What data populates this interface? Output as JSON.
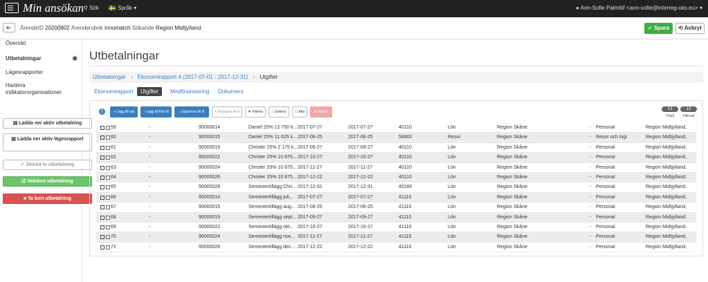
{
  "app": {
    "title": "Min ansökan",
    "nav": {
      "search": "Sök",
      "language": "Språk"
    },
    "user": "Ann-Sofie Palmlöf <ann-sofie@interreg-oks.eu>"
  },
  "subbar": {
    "arende_label": "ÄrendeID",
    "arende_id": "20200802",
    "rubrik_label": "Ärenderubrik",
    "rubrik_value": "Innomatch",
    "sokande_label": "Sökande",
    "sokande_value": "Region Midtjylland.",
    "save_label": "Spara",
    "cancel_label": "Avbryt"
  },
  "sidebar": {
    "items": [
      {
        "label": "Översikt"
      },
      {
        "label": "Utbetalningar"
      },
      {
        "label": "Lägesrapporter"
      },
      {
        "label": "Hantera indikatororganisationer"
      }
    ],
    "buttons": {
      "download_payment": "Ladda ner aktiv utbetalning",
      "download_report": "Ladda ner aktiv lägesrapport",
      "send_payment": "Skicka in utbetalning",
      "validate_payment": "Validera utbetalning",
      "delete_payment": "Ta bort utbetalning"
    }
  },
  "main": {
    "title": "Utbetalningar",
    "breadcrumb": {
      "item1": "Utbetalningar",
      "item2": "Ekonomirapport 4 (2017-07-01 - 2017-12-31)",
      "current": "Utgifter"
    },
    "tabs": {
      "ekonomirapport": "Ekonomirapport",
      "utgifter": "Utgifter",
      "medfinansiering": "Medfinansiering",
      "dokument": "Dokument"
    },
    "toolbar": {
      "add_row": "Lägg till rad",
      "add_from_file": "Lägg till från fil",
      "export_file": "Exportera till fil",
      "edit_many": "Redigera flera",
      "filter": "Filtrera",
      "sort": "Sortera",
      "all": "Alla",
      "delete": "Ta bort"
    },
    "counts": {
      "total": "13",
      "total_label": "Totalt",
      "filtered": "13",
      "filtered_label": "Filtrerat"
    },
    "rows": [
      {
        "id": "59",
        "dash": "-",
        "ver": "90000014",
        "text": "Daniel 25% 12 750 k...",
        "date1": "2017-07-27",
        "date2": "2017-07-27",
        "konto": "40110",
        "typ": "Lön",
        "region": "Region Skåne",
        "dash2": "-",
        "kat": "Personal",
        "org": "Region Midtjylland,"
      },
      {
        "id": "60",
        "dash": "-",
        "ver": "90000015",
        "text": "Daniel 25% 11 625 k...",
        "date1": "2017-08-25",
        "date2": "2017-08-25",
        "konto": "58900",
        "typ": "Resor",
        "region": "Region Skåne",
        "dash2": "-",
        "kat": "Resor och logi",
        "org": "Region Midtjylland,"
      },
      {
        "id": "61",
        "dash": "-",
        "ver": "90000019",
        "text": "Christer 25% 2 175 k...",
        "date1": "2017-09-27",
        "date2": "2017-09-27",
        "konto": "40110",
        "typ": "Lön",
        "region": "Region Skåne",
        "dash2": "-",
        "kat": "Personal",
        "org": "Region Midtjylland,"
      },
      {
        "id": "62",
        "dash": "-",
        "ver": "90000022",
        "text": "Christer 25% 10 875...",
        "date1": "2017-10-27",
        "date2": "2017-10-27",
        "konto": "40110",
        "typ": "Lön",
        "region": "Region Skåne",
        "dash2": "-",
        "kat": "Personal",
        "org": "Region Midtjylland,"
      },
      {
        "id": "63",
        "dash": "-",
        "ver": "90000024",
        "text": "Christer 25% 10 875...",
        "date1": "2017-11-27",
        "date2": "2017-11-27",
        "konto": "40110",
        "typ": "Lön",
        "region": "Region Skåne",
        "dash2": "-",
        "kat": "Personal",
        "org": "Region Midtjylland,"
      },
      {
        "id": "64",
        "dash": "-",
        "ver": "90000026",
        "text": "Christer 25% 10 875...",
        "date1": "2017-12-22",
        "date2": "2017-12-22",
        "konto": "40110",
        "typ": "Lön",
        "region": "Region Skåne",
        "dash2": "-",
        "kat": "Personal",
        "org": "Region Midtjylland,"
      },
      {
        "id": "65",
        "dash": "-",
        "ver": "90000028",
        "text": "Semestertillägg Chri...",
        "date1": "2017-12-31",
        "date2": "2017-12-31",
        "konto": "40180",
        "typ": "Lön",
        "region": "Region Skåne",
        "dash2": "-",
        "kat": "Personal",
        "org": "Region Midtjylland,"
      },
      {
        "id": "66",
        "dash": "-",
        "ver": "90000014",
        "text": "Semestertillägg juli...",
        "date1": "2017-07-27",
        "date2": "2017-07-27",
        "konto": "41110",
        "typ": "Lön",
        "region": "Region Skåne",
        "dash2": "-",
        "kat": "Personal",
        "org": "Region Midtjylland,"
      },
      {
        "id": "67",
        "dash": "-",
        "ver": "90000015",
        "text": "Semestertillägg aug...",
        "date1": "2017-08-25",
        "date2": "2017-08-25",
        "konto": "41110",
        "typ": "Lön",
        "region": "Region Skåne",
        "dash2": "-",
        "kat": "Personal",
        "org": "Region Midtjylland,"
      },
      {
        "id": "68",
        "dash": "-",
        "ver": "90000019",
        "text": "Semestertillägg sept...",
        "date1": "2017-09-27",
        "date2": "2017-09-27",
        "konto": "41110",
        "typ": "Lön",
        "region": "Region Skåne",
        "dash2": "-",
        "kat": "Personal",
        "org": "Region Midtjylland,"
      },
      {
        "id": "69",
        "dash": "-",
        "ver": "90000022",
        "text": "Semestertillägg okt...",
        "date1": "2017-10-27",
        "date2": "2017-10-27",
        "konto": "41110",
        "typ": "Lön",
        "region": "Region Skåne",
        "dash2": "-",
        "kat": "Personal",
        "org": "Region Midtjylland,"
      },
      {
        "id": "70",
        "dash": "-",
        "ver": "90000024",
        "text": "Semestertillägg nov...",
        "date1": "2017-11-27",
        "date2": "2017-11-27",
        "konto": "41110",
        "typ": "Lön",
        "region": "Region Skåne",
        "dash2": "-",
        "kat": "Personal",
        "org": "Region Midtjylland,"
      },
      {
        "id": "71",
        "dash": "-",
        "ver": "90000026",
        "text": "Semestertillägg dec...",
        "date1": "2017-12-22",
        "date2": "2017-12-22",
        "konto": "41110",
        "typ": "Lön",
        "region": "Region Skåne",
        "dash2": "-",
        "kat": "Personal",
        "org": "Region Midtjylland,"
      }
    ]
  }
}
